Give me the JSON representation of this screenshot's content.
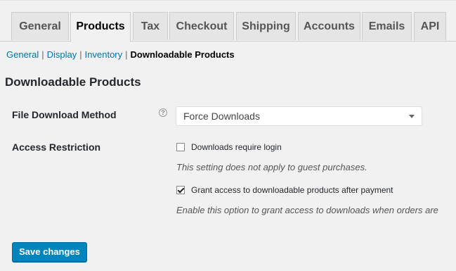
{
  "tabs": [
    {
      "label": "General",
      "active": false
    },
    {
      "label": "Products",
      "active": true
    },
    {
      "label": "Tax",
      "active": false
    },
    {
      "label": "Checkout",
      "active": false
    },
    {
      "label": "Shipping",
      "active": false
    },
    {
      "label": "Accounts",
      "active": false
    },
    {
      "label": "Emails",
      "active": false
    },
    {
      "label": "API",
      "active": false
    }
  ],
  "subnav": {
    "items": [
      "General",
      "Display",
      "Inventory"
    ],
    "separator": "|",
    "current": "Downloadable Products"
  },
  "section_title": "Downloadable Products",
  "fields": {
    "download_method": {
      "label": "File Download Method",
      "help_icon": "?",
      "value": "Force Downloads"
    },
    "access_restriction": {
      "label": "Access Restriction",
      "require_login": {
        "label": "Downloads require login",
        "checked": false,
        "description": "This setting does not apply to guest purchases."
      },
      "grant_access": {
        "label": "Grant access to downloadable products after payment",
        "checked": true,
        "description": "Enable this option to grant access to downloads when orders are"
      }
    }
  },
  "save_button": "Save changes",
  "colors": {
    "primary_button": "#0085ba",
    "link": "#0073aa",
    "background": "#f1f1f1"
  }
}
